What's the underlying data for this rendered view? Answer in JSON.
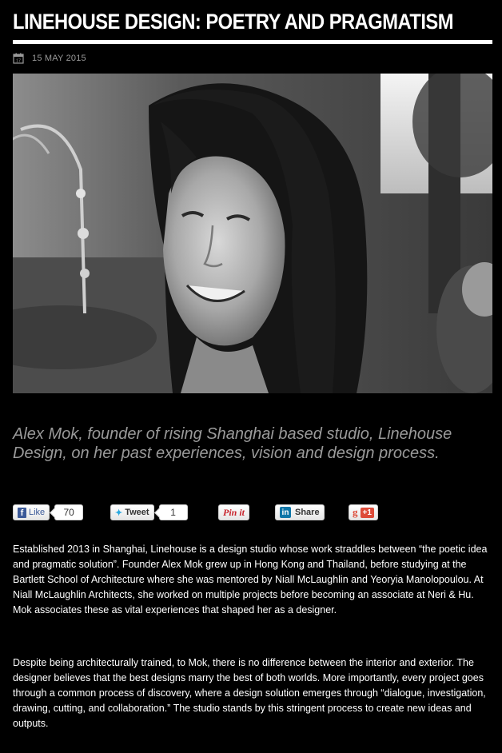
{
  "article": {
    "title": "LINEHOUSE DESIGN: POETRY AND PRAGMATISM",
    "date": "15 MAY 2015",
    "subtitle": "Alex Mok, founder of rising Shanghai based studio, Linehouse Design, on her past experiences, vision and design process.",
    "paragraphs": [
      "Established 2013 in Shanghai, Linehouse is a design studio whose work straddles between “the poetic idea and pragmatic solution”. Founder Alex Mok grew up in Hong Kong and Thailand, before studying at the Bartlett School of Architecture where she was mentored by Niall McLaughlin and Yeoryia Manolopoulou. At Niall McLaughlin Architects, she worked on multiple projects before becoming an associate at Neri & Hu. Mok associates these as vital experiences that shaped her as a designer.",
      "Despite being architecturally trained, to Mok, there is no difference between the interior and exterior. The designer believes that the best designs marry the best of both worlds. More importantly, every project goes through a common process of discovery, where a design solution emerges through “dialogue, investigation, drawing, cutting, and collaboration.” The studio stands by this stringent process to create new ideas and outputs."
    ]
  },
  "share": {
    "facebook": {
      "icon_letter": "f",
      "label": "Like",
      "count": "70"
    },
    "twitter": {
      "label": "Tweet",
      "count": "1"
    },
    "pinterest": {
      "label": "Pin it"
    },
    "linkedin": {
      "icon_letter": "in",
      "label": "Share"
    },
    "googleplus": {
      "icon_letter": "g",
      "label": "+1"
    }
  },
  "icons": {
    "calendar": "calendar-icon",
    "photo": "portrait-photo"
  },
  "colors": {
    "background": "#000000",
    "text": "#ffffff",
    "subtitle": "#9a9a9a",
    "date": "#999999",
    "facebook": "#3b5998",
    "twitter": "#2aa9e0",
    "pinterest": "#c8232c",
    "linkedin": "#0e76a8",
    "googleplus": "#dd4b39"
  }
}
